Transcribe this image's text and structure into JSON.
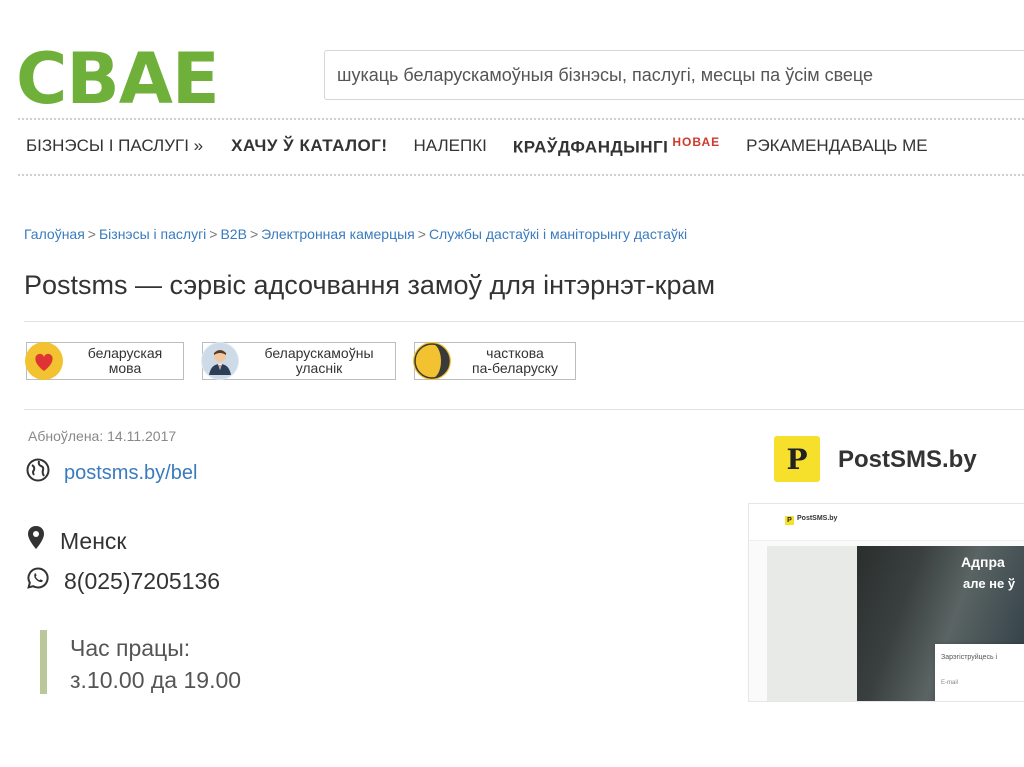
{
  "header": {
    "logo": "СВАЕ",
    "search_placeholder": "шукаць беларускамоўныя бізнэсы, паслугі, месцы па ўсім свеце"
  },
  "nav": {
    "items": [
      {
        "label": "БІЗНЭСЫ І ПАСЛУГІ  »"
      },
      {
        "label": "ХАЧУ Ў КАТАЛОГ!"
      },
      {
        "label": "НАЛЕПКІ"
      },
      {
        "label": "КРАЎДФАНДЫНГІ",
        "badge": "НОВАЕ"
      },
      {
        "label": "РЭКАМЕНДАВАЦЬ МЕ"
      }
    ]
  },
  "breadcrumb": {
    "items": [
      "Галоўная",
      "Бізнэсы і паслугі",
      "B2B",
      "Электронная камерцыя",
      "Службы дастаўкі і маніторынгу дастаўкі"
    ],
    "separator": ">"
  },
  "page_title": "Postsms — сэрвіс адсочвання замоў для інтэрнэт-крам",
  "badges": [
    {
      "line1": "беларуская",
      "line2": "мова",
      "icon": "heart-icon"
    },
    {
      "line1": "беларускамоўны",
      "line2": "уласнік",
      "icon": "person-icon"
    },
    {
      "line1": "часткова",
      "line2": "па-беларуску",
      "icon": "half-moon-icon"
    }
  ],
  "info": {
    "updated": "Абноўлена: 14.11.2017",
    "website": "postsms.by/bel",
    "city": "Менск",
    "phone": "8(025)7205136",
    "hours_label": "Час працы:",
    "hours_value": "з.10.00 да 19.00"
  },
  "company": {
    "logo_letter": "P",
    "name": "PostSMS.by"
  },
  "screenshot_preview": {
    "mini_logo_letter": "P",
    "mini_brand": "PostSMS.by",
    "headline_1": "Адпра",
    "headline_2": "але не ў",
    "form_title": "Зарэгіструйцесь і",
    "form_field": "E-mail"
  },
  "colors": {
    "brand_green": "#6fb03a",
    "link_blue": "#3a7bbf",
    "new_red": "#d03a2b",
    "logo_yellow": "#f7e02b"
  }
}
